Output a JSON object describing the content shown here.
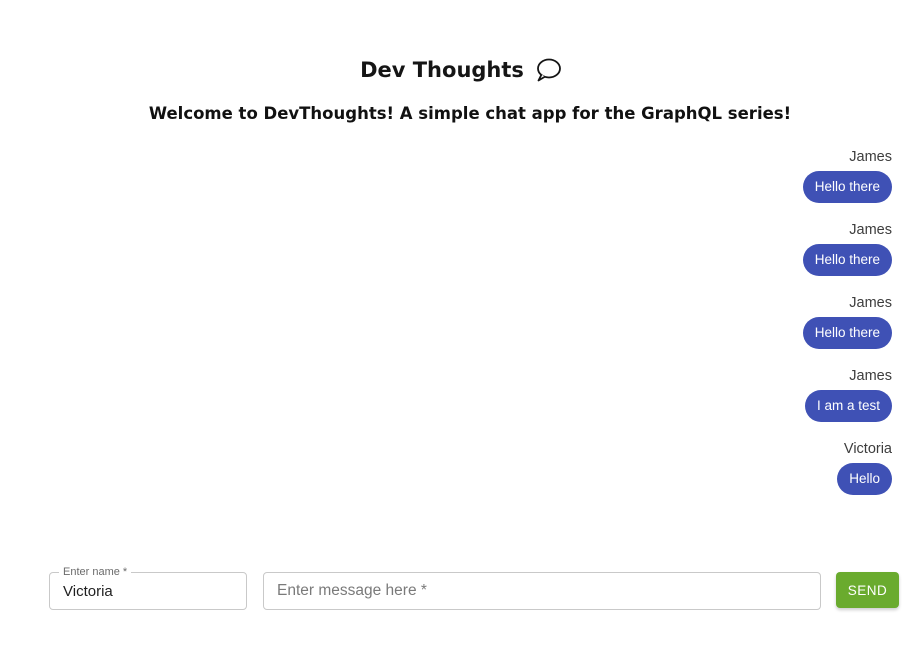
{
  "header": {
    "title": "Dev Thoughts",
    "icon": "speech-bubble-icon",
    "subtitle": "Welcome to DevThoughts! A simple chat app for the GraphQL series!"
  },
  "messages": [
    {
      "sender": "James",
      "text": "Hello there"
    },
    {
      "sender": "James",
      "text": "Hello there"
    },
    {
      "sender": "James",
      "text": "Hello there"
    },
    {
      "sender": "James",
      "text": "I am a test"
    },
    {
      "sender": "Victoria",
      "text": "Hello"
    }
  ],
  "composer": {
    "name_label": "Enter name *",
    "name_value": "Victoria",
    "message_placeholder": "Enter message here *",
    "message_value": "",
    "send_label": "SEND"
  },
  "colors": {
    "bubble": "#3f51b5",
    "send_button": "#6aab2e"
  }
}
